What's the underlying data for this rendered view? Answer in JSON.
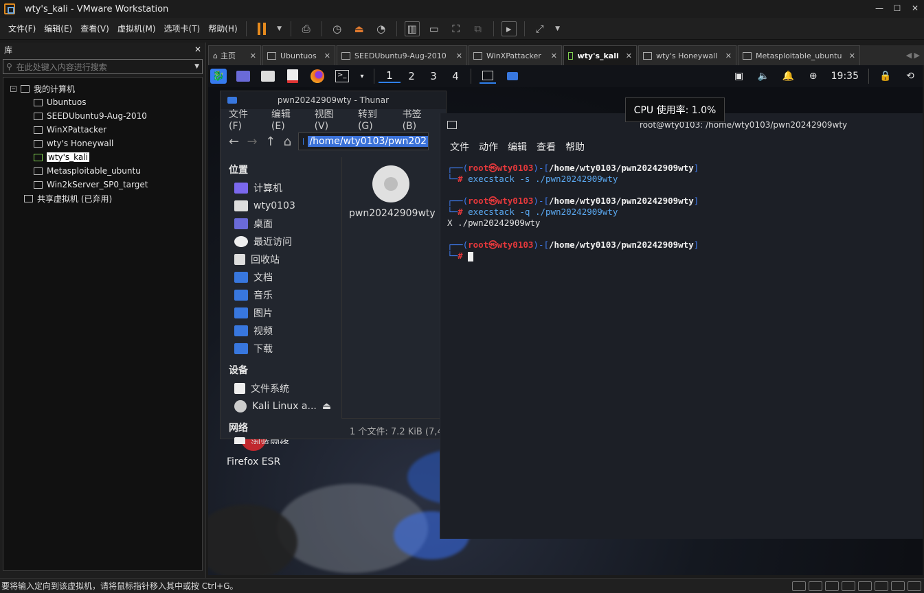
{
  "window": {
    "title": "wty's_kali - VMware Workstation"
  },
  "menubar": [
    "文件(F)",
    "编辑(E)",
    "查看(V)",
    "虚拟机(M)",
    "选项卡(T)",
    "帮助(H)"
  ],
  "library": {
    "title": "库",
    "search_placeholder": "在此处键入内容进行搜索",
    "root": "我的计算机",
    "vms": [
      "Ubuntuos",
      "SEEDUbuntu9-Aug-2010",
      "WinXPattacker",
      "wty's Honeywall",
      "wty's_kali",
      "Metasploitable_ubuntu",
      "Win2kServer_SP0_target"
    ],
    "selected": "wty's_kali",
    "shared": "共享虚拟机 (已弃用)"
  },
  "tabs": [
    "主页",
    "Ubuntuos",
    "SEEDUbuntu9-Aug-2010",
    "WinXPattacker",
    "wty's_kali",
    "wty's Honeywall",
    "Metasploitable_ubuntu"
  ],
  "active_tab": "wty's_kali",
  "kali_panel": {
    "workspaces": [
      "1",
      "2",
      "3",
      "4"
    ],
    "clock": "19:35"
  },
  "tooltip": "CPU 使用率: 1.0%",
  "thunar": {
    "title": "pwn20242909wty - Thunar",
    "menu": [
      "文件(F)",
      "编辑(E)",
      "视图(V)",
      "转到(G)",
      "书签(B)"
    ],
    "path": "/home/wty0103/pwn202",
    "places_header": "位置",
    "places": [
      "计算机",
      "wty0103",
      "桌面",
      "最近访问",
      "回收站",
      "文档",
      "音乐",
      "图片",
      "视频",
      "下载"
    ],
    "devices_header": "设备",
    "devices": [
      "文件系统",
      "Kali Linux a..."
    ],
    "network_header": "网络",
    "network_partial": "浏览网络",
    "file_name": "pwn20242909wty",
    "status": "1 个文件: 7.2 KiB (7,4"
  },
  "terminal": {
    "title": "root@wty0103: /home/wty0103/pwn20242909wty",
    "menu": [
      "文件",
      "动作",
      "编辑",
      "查看",
      "帮助"
    ],
    "user": "root",
    "at": "㉿",
    "host": "wty0103",
    "cwd": "/home/wty0103/pwn20242909wty",
    "cmd1": "execstack -s ./pwn20242909wty",
    "cmd2": "execstack -q ./pwn20242909wty",
    "out2": "X ./pwn20242909wty"
  },
  "desktop": {
    "firefox_label": "Firefox ESR"
  },
  "statusbar": "要将输入定向到该虚拟机，请将鼠标指针移入其中或按 Ctrl+G。"
}
